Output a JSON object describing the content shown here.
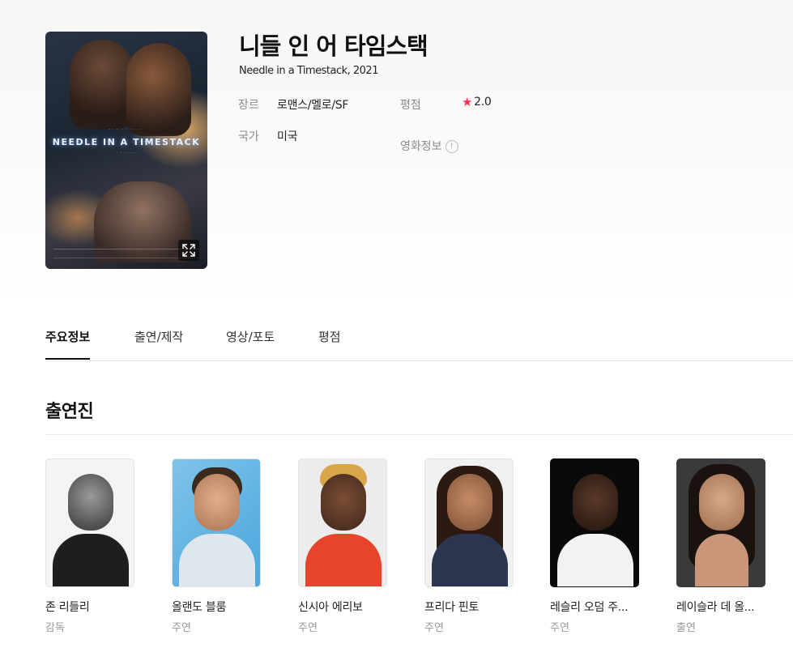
{
  "movie": {
    "title": "니들 인 어 타임스택",
    "subtitle": "Needle in a Timestack, 2021",
    "poster": {
      "title_art": "NEEDLE IN A TIMESTACK",
      "expand_icon": "expand-icon"
    },
    "info": {
      "genre_label": "장르",
      "genre_value": "로맨스/멜로/SF",
      "country_label": "국가",
      "country_value": "미국",
      "rating_label": "평점",
      "rating_value": "2.0",
      "rating_icon": "star-icon",
      "info_label": "영화정보",
      "info_icon": "!"
    }
  },
  "tabs": [
    {
      "label": "주요정보",
      "active": true
    },
    {
      "label": "출연/제작",
      "active": false
    },
    {
      "label": "영상/포토",
      "active": false
    },
    {
      "label": "평점",
      "active": false
    }
  ],
  "cast": {
    "section_title": "출연진",
    "members": [
      {
        "name": "존 리들리",
        "role": "감독"
      },
      {
        "name": "올랜도 블룸",
        "role": "주연"
      },
      {
        "name": "신시아 에리보",
        "role": "주연"
      },
      {
        "name": "프리다 핀토",
        "role": "주연"
      },
      {
        "name": "레슬리 오덤 주...",
        "role": "주연"
      },
      {
        "name": "레이슬라 데 올...",
        "role": "출연"
      }
    ]
  },
  "colors": {
    "rating_star": "#ff2f4e",
    "active_tab": "#111111",
    "muted_text": "#8a8a8a"
  }
}
